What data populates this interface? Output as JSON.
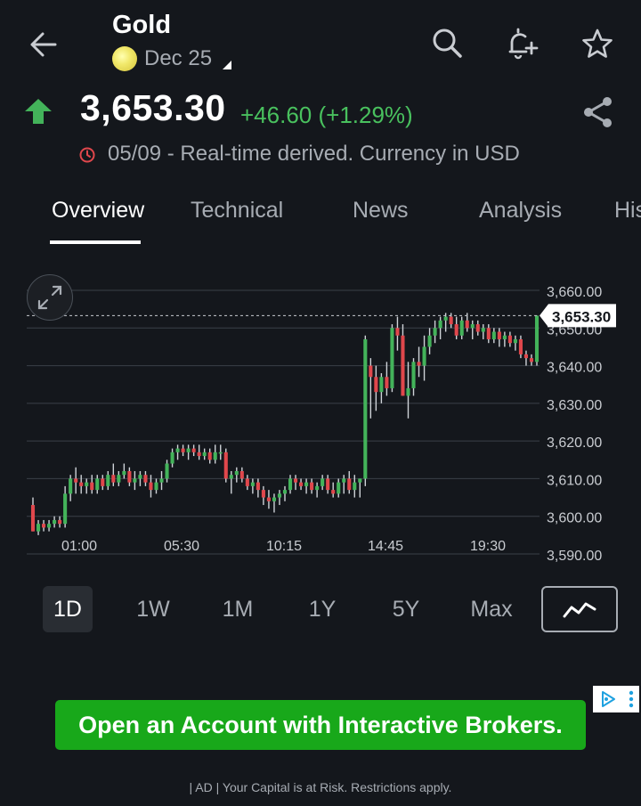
{
  "header": {
    "title": "Gold",
    "contract": "Dec 25",
    "icons": [
      "back-arrow-icon",
      "search-icon",
      "bell-plus-icon",
      "star-icon"
    ]
  },
  "quote": {
    "price": "3,653.30",
    "change": "+46.60 (+1.29%)",
    "direction": "up",
    "meta": "05/09 - Real-time derived. Currency in USD",
    "icons": [
      "share-icon",
      "clock-icon"
    ]
  },
  "tabs": [
    {
      "label": "Overview",
      "active": true
    },
    {
      "label": "Technical",
      "active": false
    },
    {
      "label": "News",
      "active": false
    },
    {
      "label": "Analysis",
      "active": false
    },
    {
      "label": "His",
      "active": false
    }
  ],
  "chart_data": {
    "type": "candlestick",
    "y_ticks": [
      "3,660.00",
      "3,650.00",
      "3,640.00",
      "3,630.00",
      "3,620.00",
      "3,610.00",
      "3,600.00",
      "3,590.00"
    ],
    "x_ticks": [
      "01:00",
      "05:30",
      "10:15",
      "14:45",
      "19:30"
    ],
    "ylim": [
      3590,
      3660
    ],
    "last_price_label": "3,653.30",
    "last_price": 3653.3,
    "up_color": "#43b35a",
    "down_color": "#e0474c",
    "candles": [
      [
        3603,
        3605,
        3596,
        3596
      ],
      [
        3596,
        3599,
        3595,
        3598
      ],
      [
        3598,
        3599,
        3596,
        3597
      ],
      [
        3597,
        3599,
        3596,
        3598
      ],
      [
        3598,
        3600,
        3597,
        3599
      ],
      [
        3599,
        3600,
        3597,
        3598
      ],
      [
        3598,
        3608,
        3597,
        3606
      ],
      [
        3606,
        3611,
        3604,
        3610
      ],
      [
        3610,
        3613,
        3606,
        3609
      ],
      [
        3609,
        3611,
        3606,
        3608
      ],
      [
        3608,
        3610,
        3606,
        3609
      ],
      [
        3609,
        3611,
        3606,
        3607
      ],
      [
        3607,
        3611,
        3606,
        3610
      ],
      [
        3610,
        3611,
        3607,
        3608
      ],
      [
        3608,
        3612,
        3607,
        3611
      ],
      [
        3611,
        3614,
        3608,
        3609
      ],
      [
        3609,
        3612,
        3608,
        3611
      ],
      [
        3611,
        3614,
        3610,
        3612
      ],
      [
        3612,
        3613,
        3608,
        3609
      ],
      [
        3609,
        3612,
        3607,
        3610
      ],
      [
        3610,
        3612,
        3608,
        3611
      ],
      [
        3611,
        3612,
        3608,
        3609
      ],
      [
        3609,
        3611,
        3605,
        3607
      ],
      [
        3607,
        3610,
        3606,
        3609
      ],
      [
        3609,
        3612,
        3607,
        3610
      ],
      [
        3610,
        3615,
        3609,
        3614
      ],
      [
        3614,
        3618,
        3613,
        3617
      ],
      [
        3617,
        3619,
        3615,
        3618
      ],
      [
        3618,
        3619,
        3616,
        3617
      ],
      [
        3617,
        3619,
        3615,
        3618
      ],
      [
        3618,
        3619,
        3616,
        3617
      ],
      [
        3617,
        3619,
        3615,
        3616
      ],
      [
        3616,
        3618,
        3615,
        3617
      ],
      [
        3617,
        3618,
        3614,
        3615
      ],
      [
        3615,
        3619,
        3614,
        3617
      ],
      [
        3617,
        3619,
        3615,
        3617
      ],
      [
        3617,
        3618,
        3609,
        3610
      ],
      [
        3610,
        3612,
        3606,
        3611
      ],
      [
        3611,
        3613,
        3609,
        3612
      ],
      [
        3612,
        3613,
        3609,
        3610
      ],
      [
        3610,
        3611,
        3607,
        3608
      ],
      [
        3608,
        3610,
        3606,
        3609
      ],
      [
        3609,
        3610,
        3605,
        3607
      ],
      [
        3607,
        3608,
        3603,
        3605
      ],
      [
        3605,
        3607,
        3602,
        3604
      ],
      [
        3604,
        3606,
        3601,
        3605
      ],
      [
        3605,
        3607,
        3603,
        3606
      ],
      [
        3606,
        3608,
        3604,
        3607
      ],
      [
        3607,
        3611,
        3606,
        3610
      ],
      [
        3610,
        3611,
        3607,
        3609
      ],
      [
        3609,
        3610,
        3607,
        3608
      ],
      [
        3608,
        3610,
        3606,
        3609
      ],
      [
        3609,
        3610,
        3606,
        3607
      ],
      [
        3607,
        3609,
        3605,
        3608
      ],
      [
        3608,
        3611,
        3607,
        3610
      ],
      [
        3610,
        3611,
        3606,
        3607
      ],
      [
        3607,
        3609,
        3605,
        3606
      ],
      [
        3606,
        3610,
        3605,
        3609
      ],
      [
        3609,
        3611,
        3606,
        3610
      ],
      [
        3610,
        3612,
        3606,
        3607
      ],
      [
        3607,
        3611,
        3605,
        3609
      ],
      [
        3609,
        3610,
        3605,
        3610
      ],
      [
        3610,
        3648,
        3608,
        3647
      ],
      [
        3640,
        3642,
        3626,
        3637
      ],
      [
        3637,
        3640,
        3628,
        3633
      ],
      [
        3633,
        3638,
        3630,
        3637
      ],
      [
        3637,
        3641,
        3632,
        3634
      ],
      [
        3634,
        3651,
        3633,
        3650
      ],
      [
        3650,
        3653,
        3644,
        3648
      ],
      [
        3648,
        3651,
        3632,
        3632
      ],
      [
        3632,
        3641,
        3626,
        3634
      ],
      [
        3634,
        3642,
        3632,
        3641
      ],
      [
        3641,
        3645,
        3637,
        3640
      ],
      [
        3640,
        3648,
        3636,
        3645
      ],
      [
        3645,
        3650,
        3643,
        3648
      ],
      [
        3648,
        3652,
        3646,
        3650
      ],
      [
        3650,
        3653,
        3647,
        3652
      ],
      [
        3652,
        3654,
        3649,
        3653
      ],
      [
        3653,
        3654,
        3650,
        3651
      ],
      [
        3651,
        3653,
        3647,
        3648
      ],
      [
        3648,
        3653,
        3647,
        3652
      ],
      [
        3652,
        3654,
        3649,
        3650
      ],
      [
        3650,
        3652,
        3647,
        3651
      ],
      [
        3651,
        3652,
        3648,
        3649
      ],
      [
        3649,
        3651,
        3647,
        3650
      ],
      [
        3650,
        3651,
        3646,
        3647
      ],
      [
        3647,
        3650,
        3646,
        3649
      ],
      [
        3649,
        3650,
        3645,
        3647
      ],
      [
        3647,
        3649,
        3645,
        3648
      ],
      [
        3648,
        3649,
        3645,
        3646
      ],
      [
        3646,
        3648,
        3644,
        3647
      ],
      [
        3647,
        3648,
        3642,
        3643
      ],
      [
        3643,
        3644,
        3640,
        3642
      ],
      [
        3642,
        3643,
        3640,
        3641
      ],
      [
        3641,
        3653.3,
        3640,
        3653.3
      ]
    ]
  },
  "ranges": [
    {
      "label": "1D",
      "active": true
    },
    {
      "label": "1W",
      "active": false
    },
    {
      "label": "1M",
      "active": false
    },
    {
      "label": "1Y",
      "active": false
    },
    {
      "label": "5Y",
      "active": false
    },
    {
      "label": "Max",
      "active": false
    }
  ],
  "chart_type_icon": "line-chart-icon",
  "ad": {
    "button_label": "Open an Account with Interactive Brokers.",
    "disclaimer": "| AD | Your Capital is at Risk. Restrictions apply.",
    "icons": [
      "adchoices-icon",
      "more-vert-icon"
    ]
  }
}
